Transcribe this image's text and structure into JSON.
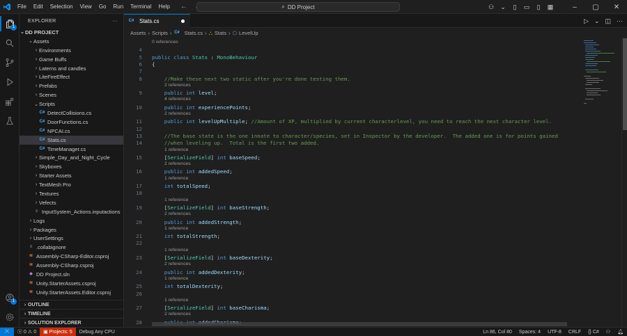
{
  "menu": [
    "File",
    "Edit",
    "Selection",
    "View",
    "Go",
    "Run",
    "Terminal",
    "Help"
  ],
  "search": {
    "text": "DD Project"
  },
  "explorer": {
    "title": "EXPLORER",
    "project": "DD PROJECT",
    "tree": [
      {
        "label": "Assets",
        "depth": 0,
        "kind": "folder-open"
      },
      {
        "label": "Environments",
        "depth": 1,
        "kind": "folder"
      },
      {
        "label": "Game Buffs",
        "depth": 1,
        "kind": "folder"
      },
      {
        "label": "Laterns and candles",
        "depth": 1,
        "kind": "folder"
      },
      {
        "label": "LiteFireEffect",
        "depth": 1,
        "kind": "folder"
      },
      {
        "label": "Prefabs",
        "depth": 1,
        "kind": "folder"
      },
      {
        "label": "Scenes",
        "depth": 1,
        "kind": "folder"
      },
      {
        "label": "Scripts",
        "depth": 1,
        "kind": "folder-open"
      },
      {
        "label": "DetectCollisions.cs",
        "depth": 2,
        "kind": "cs"
      },
      {
        "label": "DoorFunctions.cs",
        "depth": 2,
        "kind": "cs"
      },
      {
        "label": "NPCAI.cs",
        "depth": 2,
        "kind": "cs"
      },
      {
        "label": "Stats.cs",
        "depth": 2,
        "kind": "cs",
        "selected": true
      },
      {
        "label": "TimeManager.cs",
        "depth": 2,
        "kind": "cs"
      },
      {
        "label": "Simple_Day_and_Night_Cycle",
        "depth": 1,
        "kind": "folder"
      },
      {
        "label": "Skyboxes",
        "depth": 1,
        "kind": "folder"
      },
      {
        "label": "Starter Assets",
        "depth": 1,
        "kind": "folder"
      },
      {
        "label": "TextMesh Pro",
        "depth": 1,
        "kind": "folder"
      },
      {
        "label": "Textures",
        "depth": 1,
        "kind": "folder"
      },
      {
        "label": "Vefects",
        "depth": 1,
        "kind": "folder"
      },
      {
        "label": "InputSystem_Actions.inputactions",
        "depth": 1,
        "kind": "txt"
      },
      {
        "label": "Logs",
        "depth": 0,
        "kind": "folder"
      },
      {
        "label": "Packages",
        "depth": 0,
        "kind": "folder"
      },
      {
        "label": "UserSettings",
        "depth": 0,
        "kind": "folder"
      },
      {
        "label": ".collabignore",
        "depth": 0,
        "kind": "txt"
      },
      {
        "label": "Assembly-CSharp-Editor.csproj",
        "depth": 0,
        "kind": "proj"
      },
      {
        "label": "Assembly-CSharp.csproj",
        "depth": 0,
        "kind": "proj"
      },
      {
        "label": "DD Project.sln",
        "depth": 0,
        "kind": "sln"
      },
      {
        "label": "Unity.StarterAssets.csproj",
        "depth": 0,
        "kind": "proj"
      },
      {
        "label": "Unity.StarterAssets.Editor.csproj",
        "depth": 0,
        "kind": "proj"
      }
    ],
    "sections": [
      "OUTLINE",
      "TIMELINE",
      "SOLUTION EXPLORER"
    ]
  },
  "tab": {
    "label": "Stats.cs"
  },
  "breadcrumb": [
    "Assets",
    "Scripts",
    "Stats.cs",
    "Stats",
    "LevelUp"
  ],
  "code": {
    "lines": [
      {
        "n": "4",
        "ref": "0 references",
        "t": [
          [
            "",
            " "
          ]
        ]
      },
      {
        "n": "5",
        "t": [
          [
            "kw",
            "public "
          ],
          [
            "kw",
            "class "
          ],
          [
            "ty",
            "Stats"
          ],
          [
            "pu",
            " : "
          ],
          [
            "ty",
            "MonoBehaviour"
          ]
        ]
      },
      {
        "n": "6",
        "t": [
          [
            "pu",
            "{"
          ]
        ]
      },
      {
        "n": "7",
        "t": [
          [
            "",
            ""
          ]
        ]
      },
      {
        "n": "8",
        "t": [
          [
            "cm",
            "    //Make these next two static after you're done testing them."
          ]
        ]
      },
      {
        "n": "9",
        "ref": "2 references",
        "t": [
          [
            "kw",
            "    public "
          ],
          [
            "kw",
            "int "
          ],
          [
            "va",
            "level"
          ],
          [
            "pu",
            ";"
          ]
        ]
      },
      {
        "n": "10",
        "ref": "4 references",
        "t": [
          [
            "kw",
            "    public "
          ],
          [
            "kw",
            "int "
          ],
          [
            "va",
            "experiencePoints"
          ],
          [
            "pu",
            ";"
          ]
        ]
      },
      {
        "n": "11",
        "ref": "2 references",
        "t": [
          [
            "kw",
            "    public "
          ],
          [
            "kw",
            "int "
          ],
          [
            "va",
            "levelUpMultiple"
          ],
          [
            "pu",
            "; "
          ],
          [
            "cm",
            "//Amount of XP, multiplied by current characterlevel, you need to reach the next character level."
          ]
        ]
      },
      {
        "n": "12",
        "t": [
          [
            "",
            ""
          ]
        ]
      },
      {
        "n": "13",
        "t": [
          [
            "cm",
            "    //The base state is the one innate to character/species, set in Inspector by the developer.  The added one is for points gained"
          ]
        ]
      },
      {
        "n": "14",
        "t": [
          [
            "cm",
            "    //when leveling up.  Total is the first two added."
          ]
        ]
      },
      {
        "n": "15",
        "ref": "1 reference",
        "t": [
          [
            "pu",
            "    ["
          ],
          [
            "ty",
            "SerializeField"
          ],
          [
            "pu",
            "] "
          ],
          [
            "kw",
            "int "
          ],
          [
            "va",
            "baseSpeed"
          ],
          [
            "pu",
            ";"
          ]
        ]
      },
      {
        "n": "16",
        "ref": "2 references",
        "t": [
          [
            "kw",
            "    public "
          ],
          [
            "kw",
            "int "
          ],
          [
            "va",
            "addedSpeed"
          ],
          [
            "pu",
            ";"
          ]
        ]
      },
      {
        "n": "17",
        "ref": "1 reference",
        "t": [
          [
            "kw",
            "    int "
          ],
          [
            "va",
            "totalSpeed"
          ],
          [
            "pu",
            ";"
          ]
        ]
      },
      {
        "n": "18",
        "t": [
          [
            "",
            ""
          ]
        ]
      },
      {
        "n": "19",
        "ref": "1 reference",
        "t": [
          [
            "pu",
            "    ["
          ],
          [
            "ty",
            "SerializeField"
          ],
          [
            "pu",
            "] "
          ],
          [
            "kw",
            "int "
          ],
          [
            "va",
            "baseStrength"
          ],
          [
            "pu",
            ";"
          ]
        ]
      },
      {
        "n": "20",
        "ref": "2 references",
        "t": [
          [
            "kw",
            "    public "
          ],
          [
            "kw",
            "int "
          ],
          [
            "va",
            "addedStrength"
          ],
          [
            "pu",
            ";"
          ]
        ]
      },
      {
        "n": "21",
        "ref": "1 reference",
        "t": [
          [
            "kw",
            "    int "
          ],
          [
            "va",
            "totalStrength"
          ],
          [
            "pu",
            ";"
          ]
        ]
      },
      {
        "n": "22",
        "t": [
          [
            "",
            ""
          ]
        ]
      },
      {
        "n": "23",
        "ref": "1 reference",
        "t": [
          [
            "pu",
            "    ["
          ],
          [
            "ty",
            "SerializeField"
          ],
          [
            "pu",
            "] "
          ],
          [
            "kw",
            "int "
          ],
          [
            "va",
            "baseDexterity"
          ],
          [
            "pu",
            ";"
          ]
        ]
      },
      {
        "n": "24",
        "ref": "2 references",
        "t": [
          [
            "kw",
            "    public "
          ],
          [
            "kw",
            "int "
          ],
          [
            "va",
            "addedDexterity"
          ],
          [
            "pu",
            ";"
          ]
        ]
      },
      {
        "n": "25",
        "ref": "1 reference",
        "t": [
          [
            "kw",
            "    int "
          ],
          [
            "va",
            "totalDexterity"
          ],
          [
            "pu",
            ";"
          ]
        ]
      },
      {
        "n": "26",
        "t": [
          [
            "",
            ""
          ]
        ]
      },
      {
        "n": "27",
        "ref": "1 reference",
        "t": [
          [
            "pu",
            "    ["
          ],
          [
            "ty",
            "SerializeField"
          ],
          [
            "pu",
            "] "
          ],
          [
            "kw",
            "int "
          ],
          [
            "va",
            "baseCharisma"
          ],
          [
            "pu",
            ";"
          ]
        ]
      },
      {
        "n": "28",
        "ref": "2 references",
        "t": [
          [
            "kw",
            "    public "
          ],
          [
            "kw",
            "int "
          ],
          [
            "va",
            "addedCharisma"
          ],
          [
            "pu",
            ";"
          ]
        ]
      }
    ]
  },
  "status": {
    "errors": "0",
    "warnings": "0",
    "project_errors": "Projects: 5",
    "debug": "Debug Any CPU",
    "position": "Ln 86, Col 80",
    "spaces": "Spaces: 4",
    "encoding": "UTF-8",
    "eol": "CRLF",
    "language": "C#"
  },
  "colors": {
    "accent": "#0078d4",
    "error_bg": "#c72e0f"
  }
}
